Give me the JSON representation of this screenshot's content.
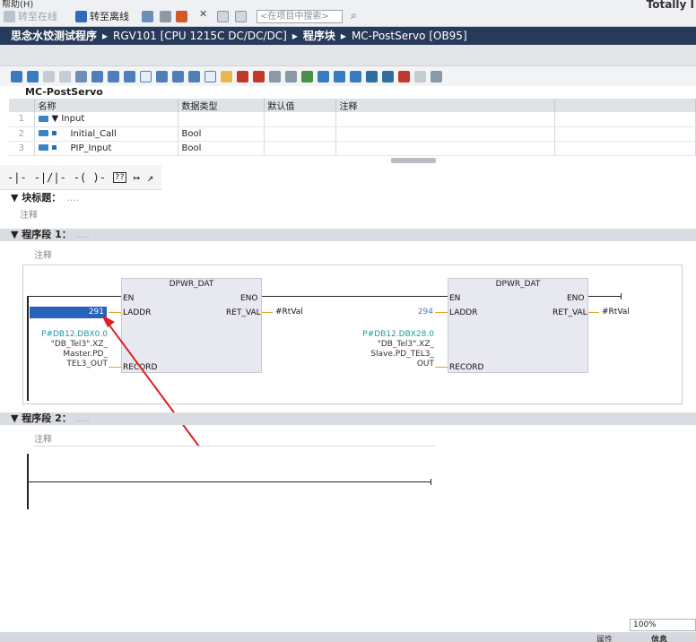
{
  "menu": {
    "help": "帮助(H)"
  },
  "brand": "Totally I",
  "toolbar": {
    "go_online": "转至在线",
    "go_offline": "转至离线",
    "search_placeholder": "<在项目中搜索>"
  },
  "breadcrumb": [
    "思念水饺测试程序",
    "RGV101 [CPU 1215C DC/DC/DC]",
    "程序块",
    "MC-PostServo [OB95]"
  ],
  "breadcrumb_sep": "▸",
  "interface": {
    "block_name": "MC-PostServo",
    "columns": [
      "名称",
      "数据类型",
      "默认值",
      "注释"
    ],
    "rows": [
      {
        "num": "1",
        "name": "▼  Input",
        "type": "",
        "default": "",
        "comment": ""
      },
      {
        "num": "2",
        "name": "Initial_Call",
        "type": "Bool",
        "default": "",
        "comment": ""
      },
      {
        "num": "3",
        "name": "PIP_Input",
        "type": "Bool",
        "default": "",
        "comment": ""
      }
    ]
  },
  "lad_toolbar": [
    "-|-",
    "-|/|-",
    "-( )-",
    "??",
    "↦",
    "↗"
  ],
  "block_title": {
    "label": "▼ 块标题：",
    "dots": "....",
    "comment": "注释"
  },
  "network1": {
    "label": "▼   程序段 1：",
    "dots": "....",
    "comment": "注释",
    "fb1": {
      "title": "DPWR_DAT",
      "en": "EN",
      "eno": "ENO",
      "laddr": "LADDR",
      "ret_val": "RET_VAL",
      "record": "RECORD",
      "laddr_value": "291",
      "ret_out": "#RtVal",
      "record_addr": "P#DB12.DBX0.0",
      "record_name": [
        "\"DB_Tel3\".XZ_",
        "Master.PD_",
        "TEL3_OUT"
      ]
    },
    "fb2": {
      "title": "DPWR_DAT",
      "en": "EN",
      "eno": "ENO",
      "laddr": "LADDR",
      "ret_val": "RET_VAL",
      "record": "RECORD",
      "laddr_value": "294",
      "ret_out": "#RtVal",
      "record_addr": "P#DB12.DBX28.0",
      "record_name": [
        "\"DB_Tel3\".XZ_",
        "Slave.PD_TEL3_",
        "OUT"
      ]
    }
  },
  "network2": {
    "label": "▼   程序段 2：",
    "dots": "....",
    "comment": "注释"
  },
  "zoom": "100%",
  "status_tabs": {
    "properties": "属性",
    "info": "信息"
  },
  "colors": {
    "breadcrumb_bg": "#283a59",
    "selection": "#2563b9",
    "annotation_arrow": "#e02020",
    "teal_operand": "#1a9aa3"
  }
}
